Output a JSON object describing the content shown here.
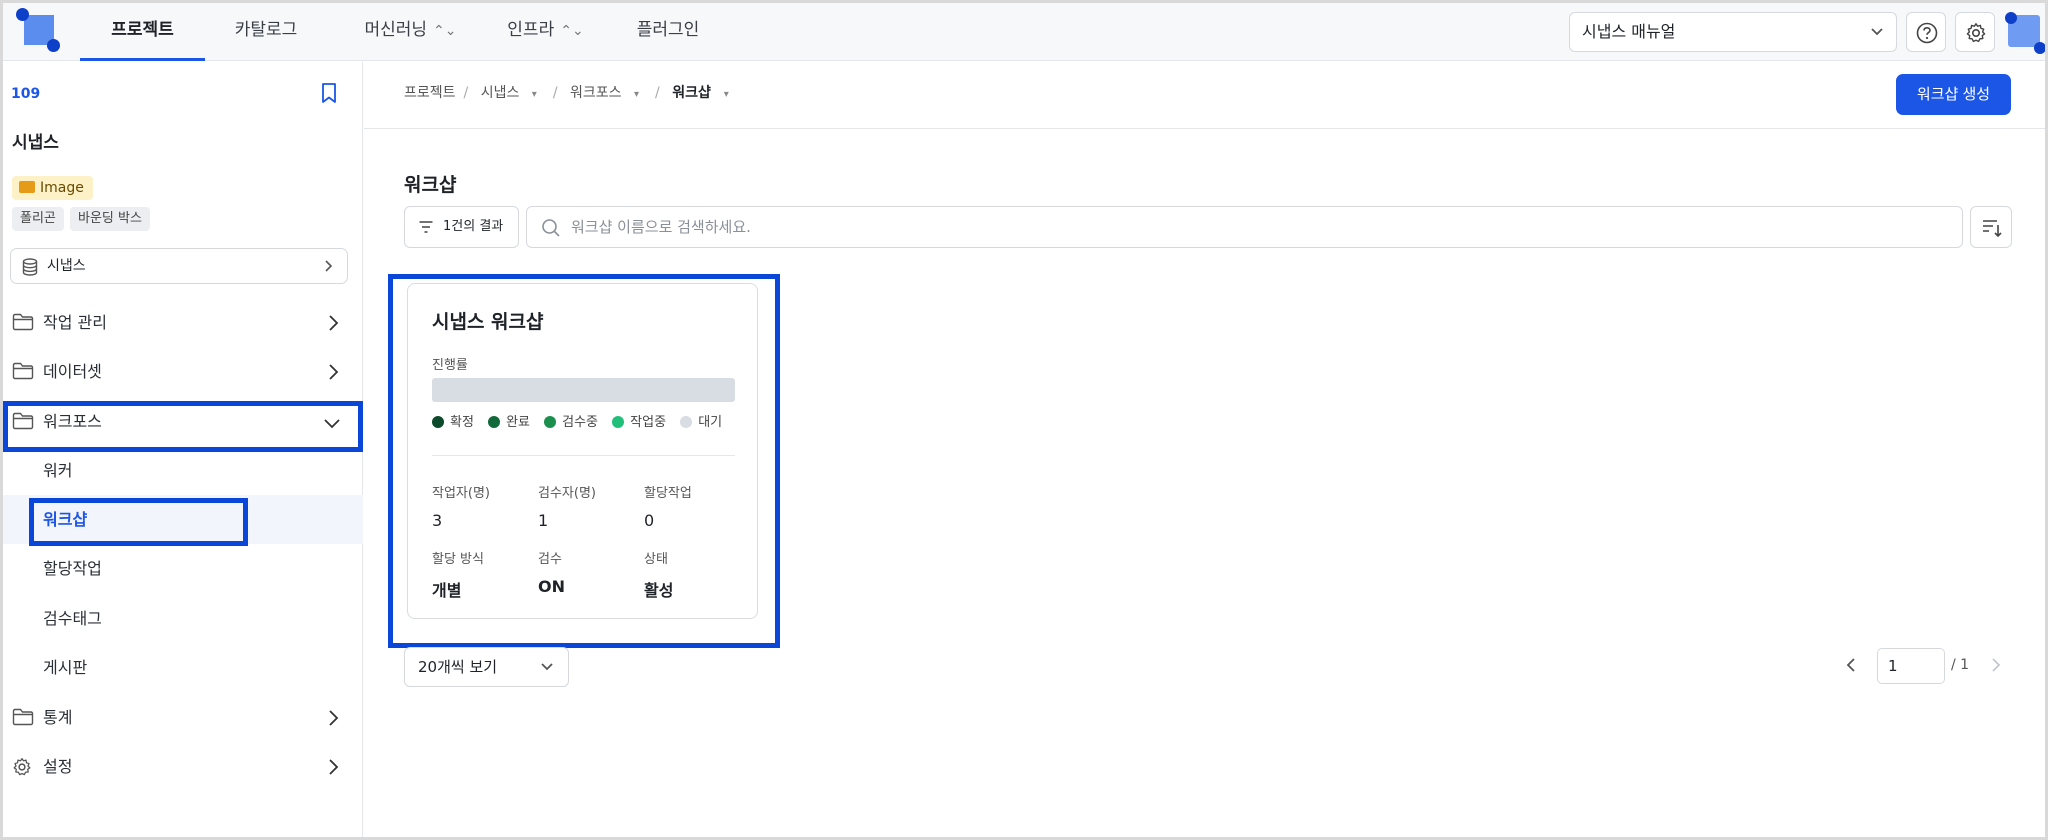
{
  "nav": {
    "tabs": [
      {
        "label": "프로젝트",
        "active": true
      },
      {
        "label": "카탈로그"
      },
      {
        "label": "머신러닝"
      },
      {
        "label": "인프라"
      },
      {
        "label": "플러그인"
      }
    ],
    "manual_select": "시냅스 매뉴얼"
  },
  "sidebar": {
    "project_id": "109",
    "project_name": "시냅스",
    "data_type": "Image",
    "annotation_tags": [
      "폴리곤",
      "바운딩 박스"
    ],
    "dataset": "시냅스",
    "menu": {
      "work_management": "작업 관리",
      "dataset": "데이터셋",
      "workforce": "워크포스",
      "workforce_sub": [
        "워커",
        "워크샵",
        "할당작업",
        "검수태그",
        "게시판"
      ],
      "statistics": "통계",
      "settings": "설정"
    }
  },
  "main": {
    "breadcrumb": [
      "프로젝트",
      "시냅스",
      "워크포스",
      "워크샵"
    ],
    "create_button": "워크샵 생성",
    "title": "워크샵",
    "filter_label": "1건의 결과",
    "search_placeholder": "워크샵 이름으로 검색하세요.",
    "card": {
      "title": "시냅스 워크샵",
      "progress_label": "진행률",
      "progress_fraction": 0,
      "legend": [
        {
          "label": "확정",
          "color": "#0b4a2a"
        },
        {
          "label": "완료",
          "color": "#12693a"
        },
        {
          "label": "검수중",
          "color": "#1a8f4e"
        },
        {
          "label": "작업중",
          "color": "#20c07a"
        },
        {
          "label": "대기",
          "color": "#d8dce3"
        }
      ],
      "stats": {
        "workers_label": "작업자(명)",
        "workers": "3",
        "reviewers_label": "검수자(명)",
        "reviewers": "1",
        "assigned_label": "할당작업",
        "assigned": "0",
        "method_label": "할당 방식",
        "method": "개별",
        "review_label": "검수",
        "review": "ON",
        "status_label": "상태",
        "status": "활성"
      }
    },
    "page_size": "20개씩 보기",
    "pager": {
      "current": "1",
      "total": "/ 1"
    }
  },
  "colors": {
    "accent": "#1c56e6",
    "highlight": "#0a46d8"
  }
}
